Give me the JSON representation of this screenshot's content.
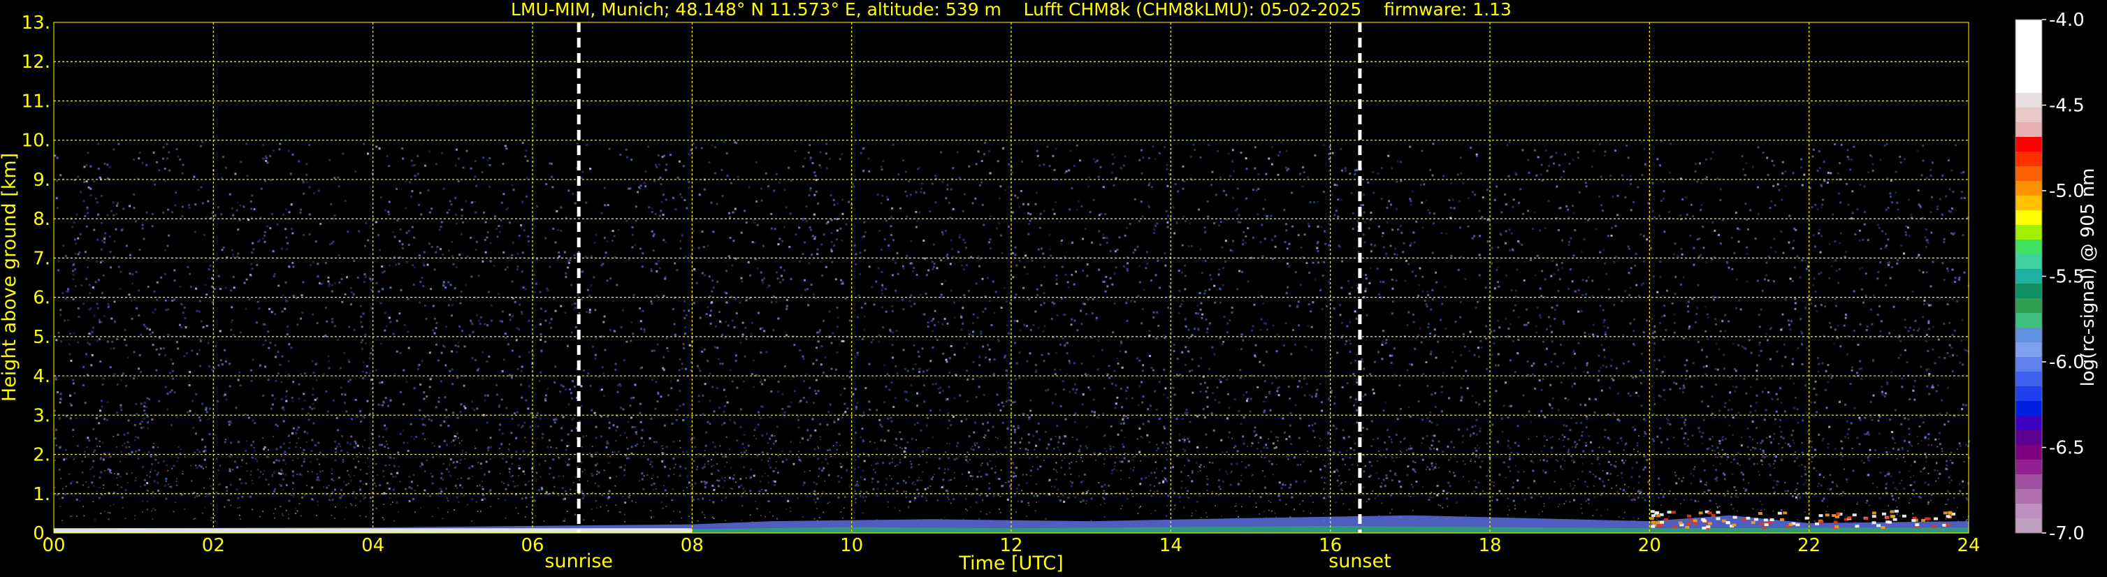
{
  "chart_data": {
    "type": "heatmap",
    "title": "LMU-MIM, Munich; 48.148° N 11.573° E, altitude: 539 m    Lufft CHM8k (CHM8kLMU): 05-02-2025    firmware: 1.13",
    "xlabel": "Time [UTC]",
    "ylabel": "Height above ground [km]",
    "xlim": [
      0,
      24
    ],
    "ylim": [
      0,
      13
    ],
    "x_ticks": [
      "00",
      "02",
      "04",
      "06",
      "08",
      "10",
      "12",
      "14",
      "16",
      "18",
      "20",
      "22",
      "24"
    ],
    "y_ticks": [
      "0.",
      "1.",
      "2.",
      "3.",
      "4.",
      "5.",
      "6.",
      "7.",
      "8.",
      "9.",
      "10.",
      "11.",
      "12.",
      "13."
    ],
    "grid": true,
    "annotations": [
      {
        "label": "sunrise",
        "x": 6.58
      },
      {
        "label": "sunset",
        "x": 16.37
      }
    ],
    "noise_top_km": 10,
    "colorbar": {
      "label": "log(rc-signal) @ 905 nm",
      "range": [
        -7.0,
        -4.0
      ],
      "ticks": [
        "-4.0",
        "-4.5",
        "-5.0",
        "-5.5",
        "-6.0",
        "-6.5",
        "-7.0"
      ]
    },
    "colors": {
      "background": "#000000",
      "text": "#ffff00",
      "grid": "#ffff00",
      "marker_lines": "#ffffff",
      "colorbar_text": "#ffffff"
    }
  }
}
